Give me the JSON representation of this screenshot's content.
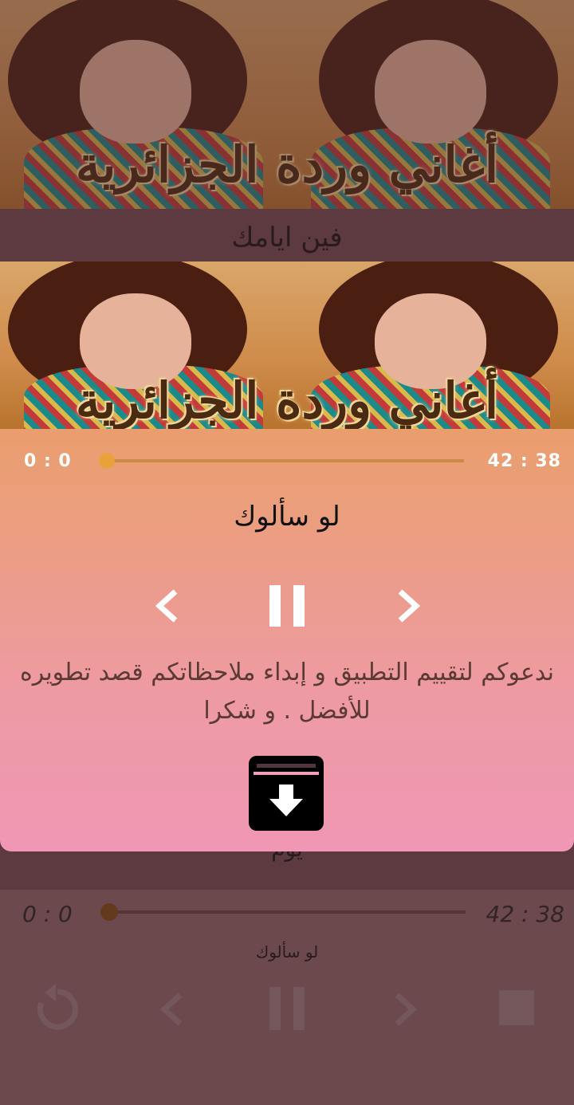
{
  "banner": {
    "title": "أغاني وردة الجزائرية"
  },
  "list": {
    "item_title_top": "فين ايامك",
    "item_title_hidden": "يوم"
  },
  "bottom_player": {
    "elapsed": "0 : 0",
    "duration": "42 : 38",
    "song": "لو سألوك",
    "progress": 0
  },
  "dialog": {
    "elapsed": "0 : 0",
    "duration": "42 : 38",
    "song": "لو سألوك",
    "message": "ندعوكم لتقييم التطبيق و إبداء ملاحظاتكم قصد تطويره للأفضل . و شكرا",
    "progress": 0
  },
  "icons": [
    "chevron-left-icon",
    "pause-icon",
    "chevron-right-icon",
    "download-icon",
    "replay-icon",
    "stop-icon"
  ]
}
